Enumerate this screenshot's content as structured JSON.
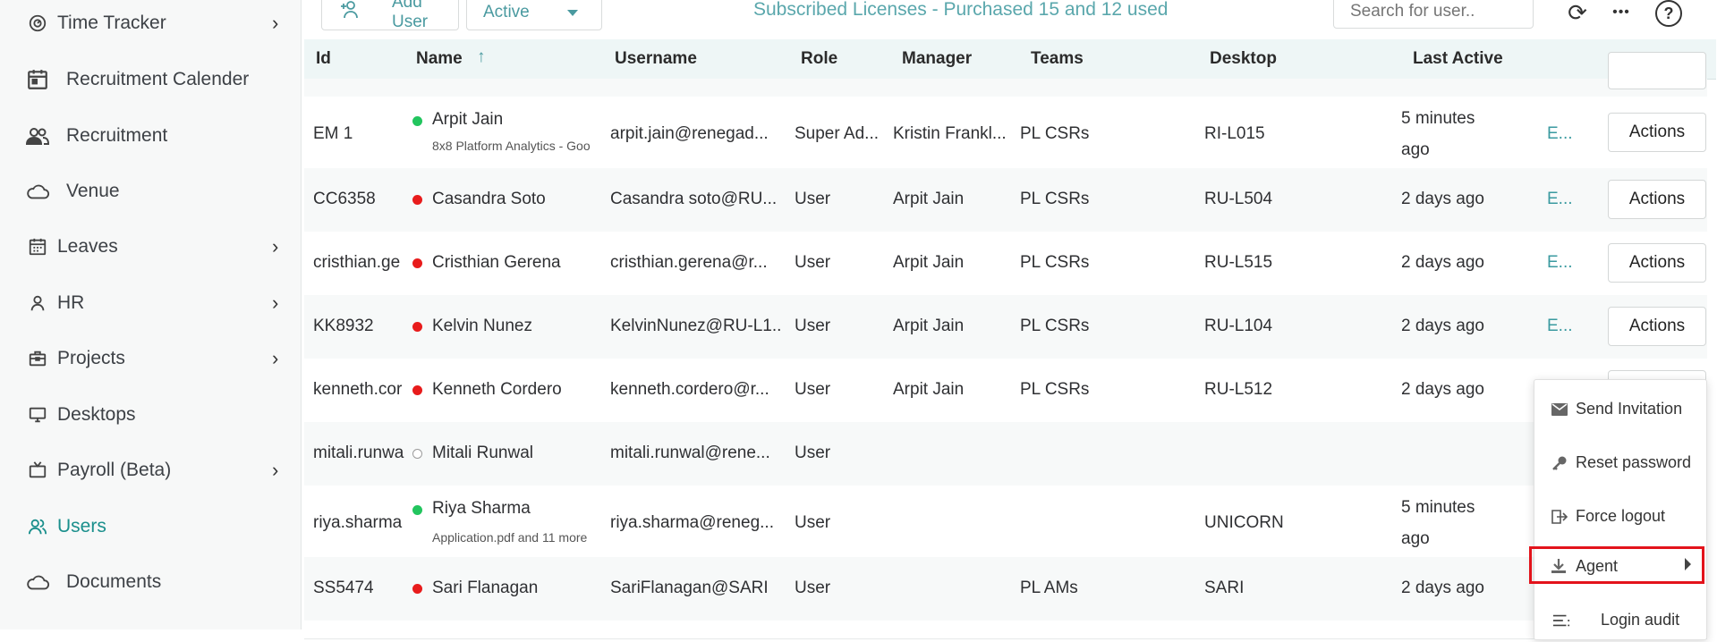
{
  "sidebar": {
    "items": [
      {
        "label": "Time Tracker",
        "icon": "timer-icon",
        "has_submenu": true
      },
      {
        "label": "Recruitment Calender",
        "icon": "calendar-icon",
        "has_submenu": false
      },
      {
        "label": "Recruitment",
        "icon": "people-icon",
        "has_submenu": false
      },
      {
        "label": "Venue",
        "icon": "cloud-icon",
        "has_submenu": false
      },
      {
        "label": "Leaves",
        "icon": "calendar-grid-icon",
        "has_submenu": true
      },
      {
        "label": "HR",
        "icon": "person-icon",
        "has_submenu": true
      },
      {
        "label": "Projects",
        "icon": "briefcase-icon",
        "has_submenu": true
      },
      {
        "label": "Desktops",
        "icon": "monitor-icon",
        "has_submenu": false
      },
      {
        "label": "Payroll (Beta)",
        "icon": "tv-icon",
        "has_submenu": true
      },
      {
        "label": "Users",
        "icon": "users-icon",
        "has_submenu": false,
        "active": true
      },
      {
        "label": "Documents",
        "icon": "cloud-icon",
        "has_submenu": false
      }
    ],
    "chevron": "›"
  },
  "toolbar": {
    "add_user_label": "Add User",
    "status_filter_value": "Active",
    "licenses_text": "Subscribed Licenses - Purchased 15 and 12 used",
    "search_placeholder": "Search for user..",
    "refresh_icon": "⟳",
    "more_icon": "•••",
    "help_icon": "?"
  },
  "table": {
    "headers": {
      "id": "Id",
      "name": "Name",
      "sort_indicator": "↑",
      "username": "Username",
      "role": "Role",
      "manager": "Manager",
      "teams": "Teams",
      "desktop": "Desktop",
      "last_active": "Last Active"
    },
    "rows": [
      {
        "id": "EM 1",
        "status": "online",
        "name": "Arpit Jain",
        "sub": "8x8 Platform Analytics - Goo",
        "username": "arpit.jain@renegad...",
        "role": "Super Ad...",
        "manager": "Kristin Frankl...",
        "teams": "PL CSRs",
        "desktop": "RI-L015",
        "last_active_1": "5 minutes",
        "last_active_2": "ago",
        "edit": "E...",
        "actions": "Actions"
      },
      {
        "id": "CC6358",
        "status": "offline",
        "name": "Casandra Soto",
        "sub": "",
        "username": "Casandra soto@RU...",
        "role": "User",
        "manager": "Arpit Jain",
        "teams": "PL CSRs",
        "desktop": "RU-L504",
        "last_active_1": "2 days ago",
        "last_active_2": "",
        "edit": "E...",
        "actions": "Actions"
      },
      {
        "id": "cristhian.ge",
        "status": "offline",
        "name": "Cristhian Gerena",
        "sub": "",
        "username": "cristhian.gerena@r...",
        "role": "User",
        "manager": "Arpit Jain",
        "teams": "PL CSRs",
        "desktop": "RU-L515",
        "last_active_1": "2 days ago",
        "last_active_2": "",
        "edit": "E...",
        "actions": "Actions"
      },
      {
        "id": "KK8932",
        "status": "offline",
        "name": "Kelvin Nunez",
        "sub": "",
        "username": "KelvinNunez@RU-L1...",
        "role": "User",
        "manager": "Arpit Jain",
        "teams": "PL CSRs",
        "desktop": "RU-L104",
        "last_active_1": "2 days ago",
        "last_active_2": "",
        "edit": "E...",
        "actions": "Actions"
      },
      {
        "id": "kenneth.cor",
        "status": "offline",
        "name": "Kenneth Cordero",
        "sub": "",
        "username": "kenneth.cordero@r...",
        "role": "User",
        "manager": "Arpit Jain",
        "teams": "PL CSRs",
        "desktop": "RU-L512",
        "last_active_1": "2 days ago",
        "last_active_2": "",
        "edit": "",
        "actions": ""
      },
      {
        "id": "mitali.runwa",
        "status": "inactive",
        "name": "Mitali Runwal",
        "sub": "",
        "username": "mitali.runwal@rene...",
        "role": "User",
        "manager": "",
        "teams": "",
        "desktop": "",
        "last_active_1": "",
        "last_active_2": "",
        "edit": "",
        "actions": ""
      },
      {
        "id": "riya.sharma",
        "status": "online",
        "name": "Riya Sharma",
        "sub": "Application.pdf and 11 more",
        "username": "riya.sharma@reneg...",
        "role": "User",
        "manager": "",
        "teams": "",
        "desktop": "UNICORN",
        "last_active_1": "5 minutes",
        "last_active_2": "ago",
        "edit": "",
        "actions": ""
      },
      {
        "id": "SS5474",
        "status": "offline",
        "name": "Sari Flanagan",
        "sub": "",
        "username": "SariFlanagan@SARI",
        "role": "User",
        "manager": "",
        "teams": "PL AMs",
        "desktop": "SARI",
        "last_active_1": "2 days ago",
        "last_active_2": "",
        "edit": "",
        "actions": ""
      }
    ]
  },
  "context_menu": {
    "items": [
      {
        "label": "Send Invitation",
        "icon": "envelope-icon"
      },
      {
        "label": "Reset password",
        "icon": "key-icon"
      },
      {
        "label": "Force logout",
        "icon": "logout-icon"
      },
      {
        "label": "Agent",
        "icon": "download-icon",
        "highlighted": true
      },
      {
        "label": "Login audit",
        "icon": "list-icon"
      }
    ]
  },
  "colors": {
    "accent": "#1a8f8c",
    "highlight_border": "#e3131b",
    "status_online": "#22c55e",
    "status_offline": "#e81c1c"
  }
}
